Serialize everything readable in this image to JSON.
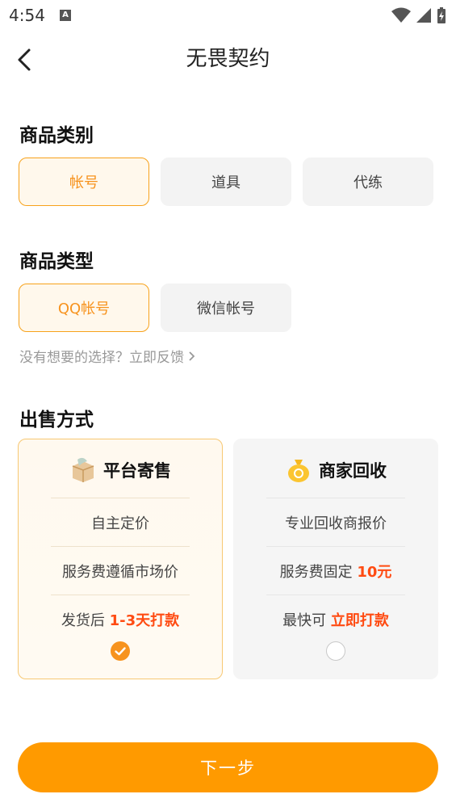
{
  "status_bar": {
    "time": "4:54",
    "notification_icon": "A"
  },
  "header": {
    "title": "无畏契约",
    "back_icon": "chevron-left-icon"
  },
  "category": {
    "title": "商品类别",
    "options": [
      {
        "label": "帐号",
        "selected": true
      },
      {
        "label": "道具",
        "selected": false
      },
      {
        "label": "代练",
        "selected": false
      }
    ]
  },
  "product_type": {
    "title": "商品类型",
    "options": [
      {
        "label": "QQ帐号",
        "selected": true
      },
      {
        "label": "微信帐号",
        "selected": false
      }
    ],
    "feedback_text": "没有想要的选择？立即反馈"
  },
  "sale_method": {
    "title": "出售方式",
    "cards": [
      {
        "name": "平台寄售",
        "icon": "parcel-box-icon",
        "selected": true,
        "row1": "自主定价",
        "row2": "服务费遵循市场价",
        "row3_prefix": "发货后 ",
        "row3_highlight": "1-3天打款"
      },
      {
        "name": "商家回收",
        "icon": "money-bag-icon",
        "selected": false,
        "row1": "专业回收商报价",
        "row2_prefix": "服务费固定 ",
        "row2_highlight": "10元",
        "row3_prefix": "最快可 ",
        "row3_highlight": "立即打款"
      }
    ]
  },
  "next_button": {
    "label": "下一步"
  },
  "colors": {
    "accent": "#ff9a00",
    "highlight": "#ff4b12",
    "selected_border": "#f7a21b"
  }
}
